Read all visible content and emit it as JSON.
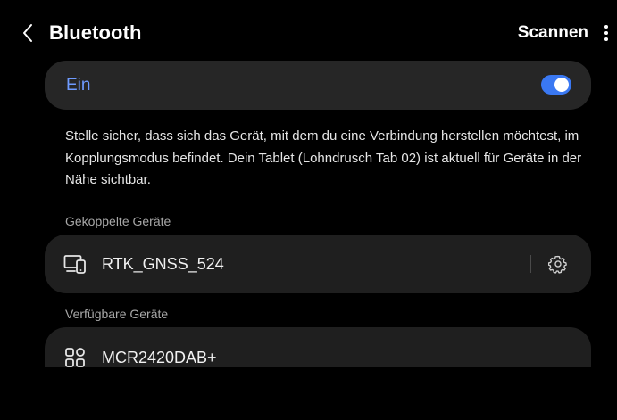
{
  "header": {
    "title": "Bluetooth",
    "scan_label": "Scannen"
  },
  "bluetooth_toggle": {
    "label": "Ein",
    "enabled": true
  },
  "description": "Stelle sicher, dass sich das Gerät, mit dem du eine Verbindung herstellen möchtest, im Kopplungsmodus befindet. Dein Tablet (Lohndrusch Tab 02) ist aktuell für Geräte in der Nähe sichtbar.",
  "paired": {
    "heading": "Gekoppelte Geräte",
    "devices": [
      {
        "name": "RTK_GNSS_524",
        "icon": "devices-icon"
      }
    ]
  },
  "available": {
    "heading": "Verfügbare Geräte",
    "devices": [
      {
        "name": "MCR2420DAB+",
        "icon": "grid-apps-icon"
      }
    ]
  },
  "colors": {
    "accent": "#3a78f2",
    "accent_text": "#6f9bff",
    "background": "#000000",
    "card": "#1f1f1f"
  }
}
